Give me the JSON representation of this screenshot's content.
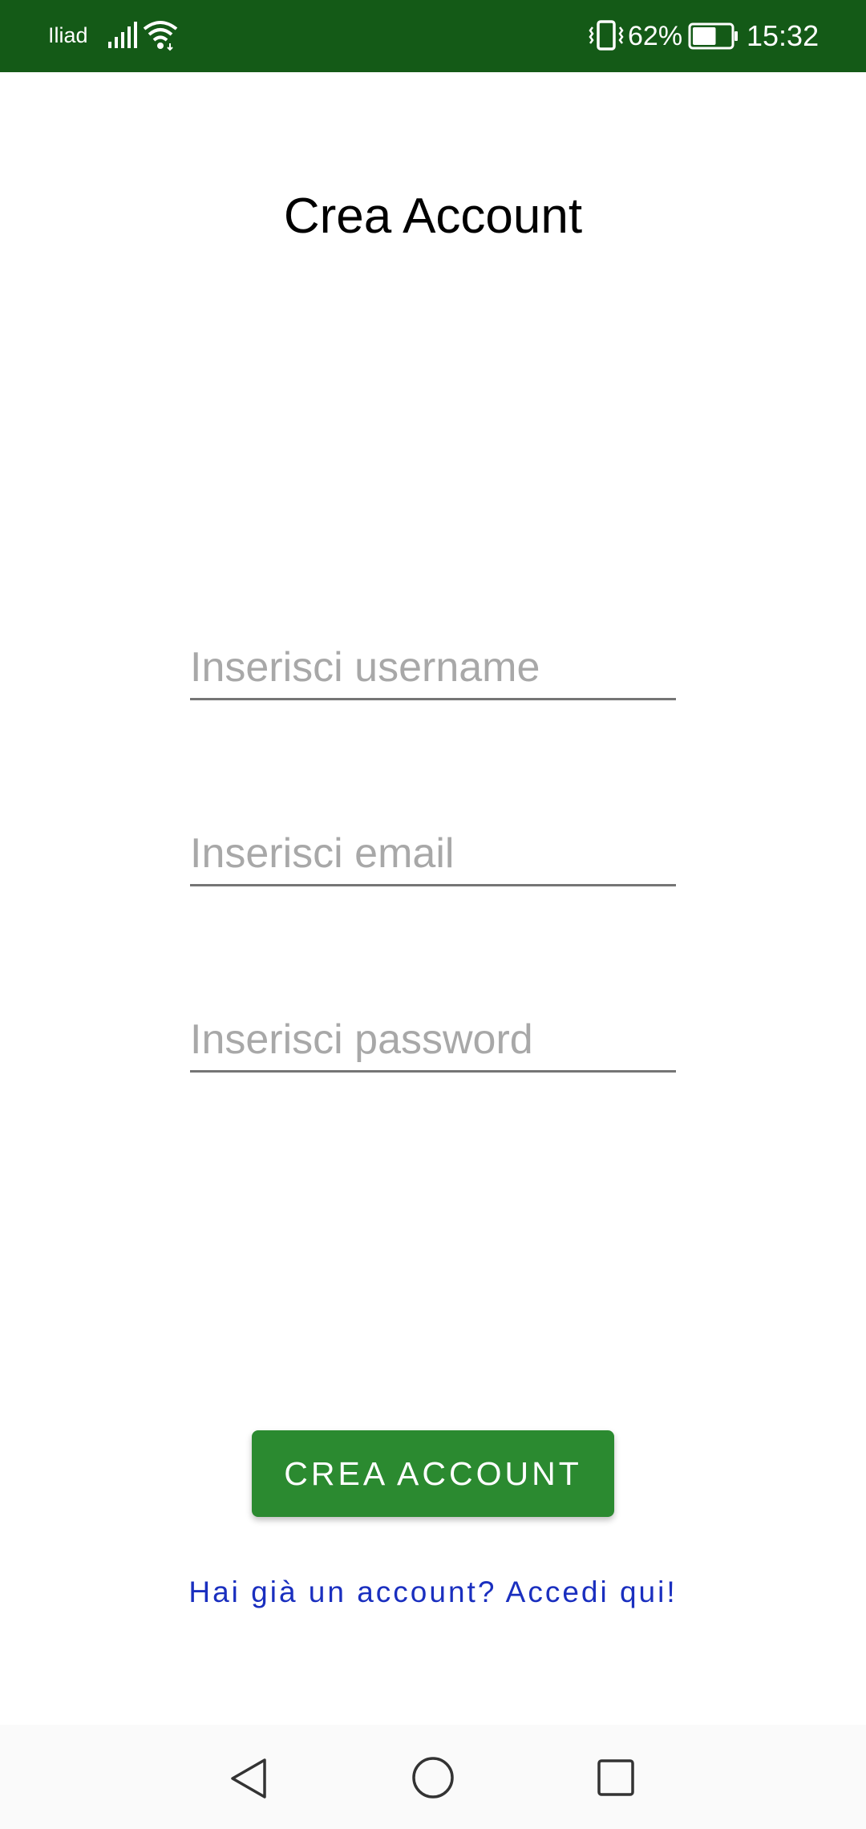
{
  "status_bar": {
    "carrier": "Iliad",
    "battery_percent": "62%",
    "battery_level": 0.62,
    "time": "15:32",
    "background_color": "#145a17",
    "icons": [
      "signal-icon",
      "wifi-icon",
      "vibrate-icon",
      "battery-icon"
    ]
  },
  "page": {
    "title": "Crea Account"
  },
  "form": {
    "username_placeholder": "Inserisci username",
    "username_value": "",
    "email_placeholder": "Inserisci email",
    "email_value": "",
    "password_placeholder": "Inserisci password",
    "password_value": ""
  },
  "actions": {
    "create_button_label": "CREA ACCOUNT",
    "create_button_color": "#2b8a30",
    "login_link_text": "Hai già un account? Accedi qui!",
    "login_link_color": "#1a2fbf"
  },
  "nav_bar": {
    "icons": [
      "back-icon",
      "home-icon",
      "recents-icon"
    ]
  }
}
